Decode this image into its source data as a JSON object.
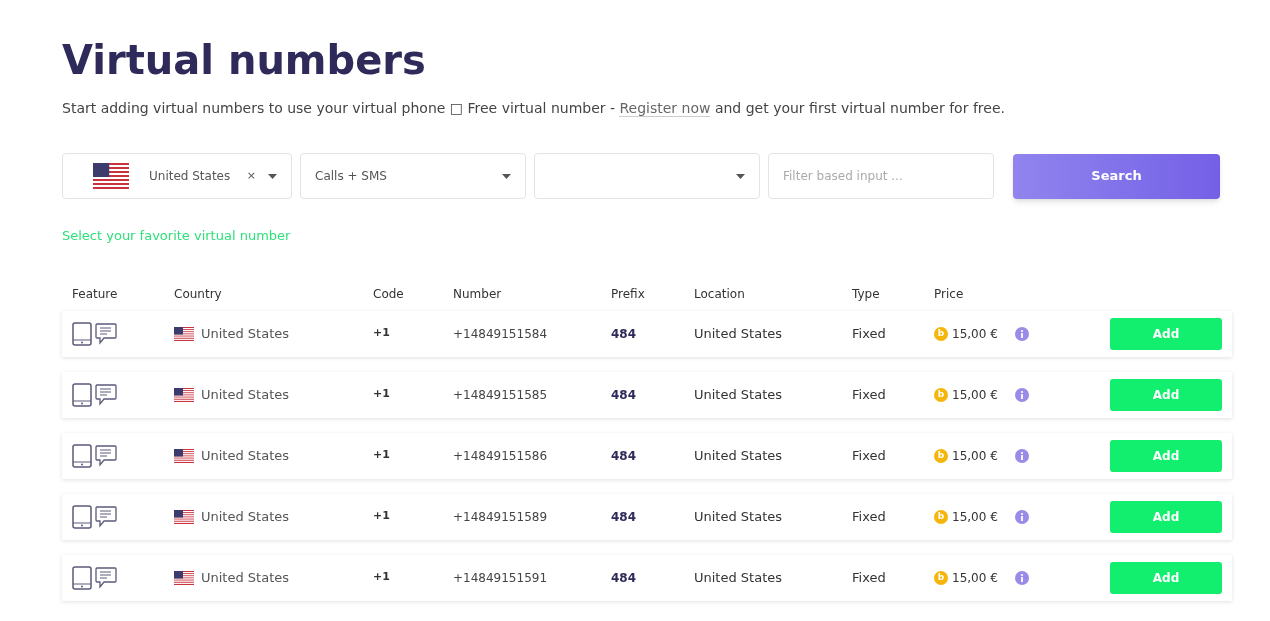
{
  "title": "Virtual numbers",
  "intro": {
    "before": "Start adding virtual numbers to use your virtual phone □ Free virtual number -",
    "link": "Register now",
    "after": "and get your first virtual number for free."
  },
  "filters": {
    "country": {
      "value": "United States",
      "clear": "×"
    },
    "service": {
      "value": "Calls + SMS"
    },
    "input": {
      "placeholder": "Filter based input ..."
    },
    "search_button": "Search"
  },
  "hint": "Select your favorite virtual number",
  "table": {
    "columns": [
      "Feature",
      "Country",
      "Code",
      "Number",
      "Prefix",
      "Location",
      "Type",
      "Price"
    ],
    "rows": [
      {
        "country": "United States",
        "code": "+1",
        "number": "+14849151584",
        "prefix": "484",
        "location": "United States",
        "type": "Fixed",
        "coin": "b",
        "price": "15,00 €",
        "action": "Add"
      },
      {
        "country": "United States",
        "code": "+1",
        "number": "+14849151585",
        "prefix": "484",
        "location": "United States",
        "type": "Fixed",
        "coin": "b",
        "price": "15,00 €",
        "action": "Add"
      },
      {
        "country": "United States",
        "code": "+1",
        "number": "+14849151586",
        "prefix": "484",
        "location": "United States",
        "type": "Fixed",
        "coin": "b",
        "price": "15,00 €",
        "action": "Add"
      },
      {
        "country": "United States",
        "code": "+1",
        "number": "+14849151589",
        "prefix": "484",
        "location": "United States",
        "type": "Fixed",
        "coin": "b",
        "price": "15,00 €",
        "action": "Add"
      },
      {
        "country": "United States",
        "code": "+1",
        "number": "+14849151591",
        "prefix": "484",
        "location": "United States",
        "type": "Fixed",
        "coin": "b",
        "price": "15,00 €",
        "action": "Add"
      }
    ]
  }
}
